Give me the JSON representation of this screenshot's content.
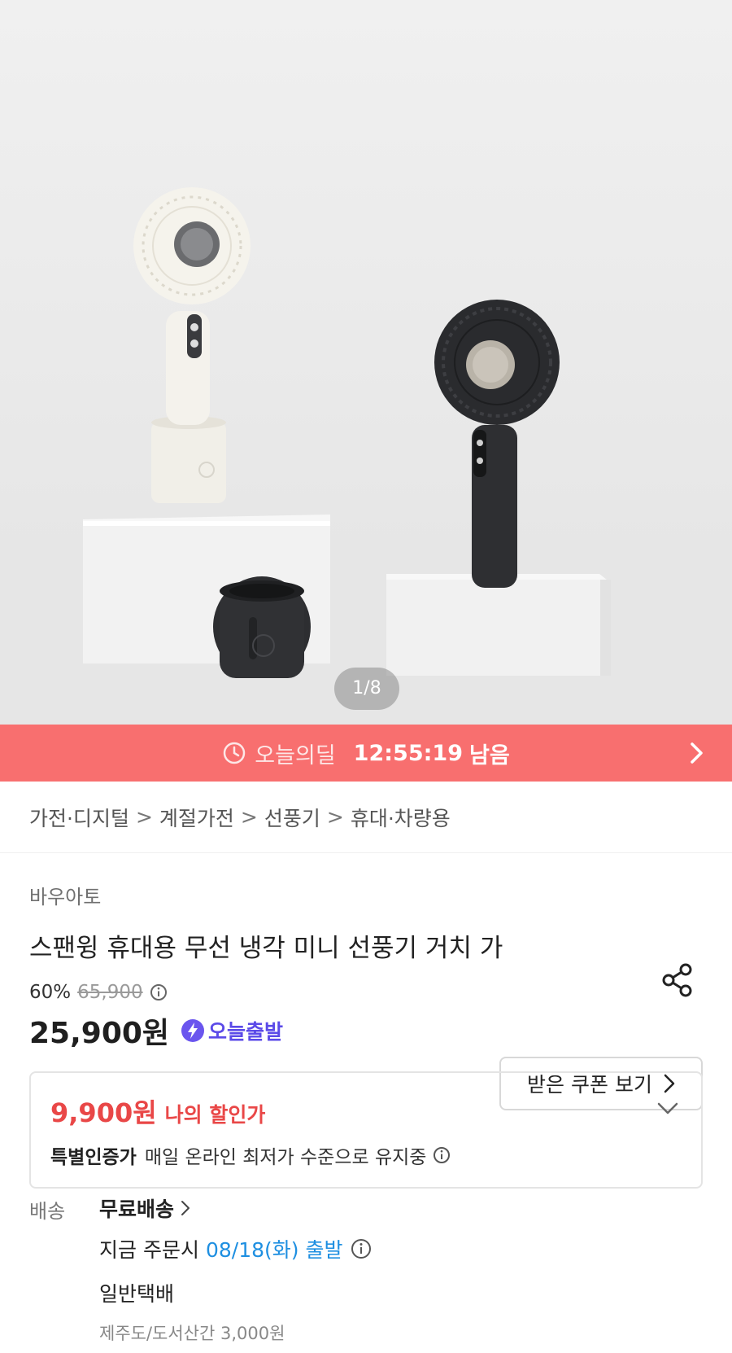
{
  "hero": {
    "image_counter": "1/8",
    "colors": {
      "background": "#ececec",
      "white_fan": "#f3f1ea",
      "black_fan": "#2f3033"
    }
  },
  "deal_banner": {
    "label": "오늘의딜",
    "timer": "12:55:19",
    "suffix": "남음",
    "background": "#f86f6f",
    "icons": [
      "clock-icon",
      "chevron-right-icon"
    ]
  },
  "breadcrumb": {
    "items": [
      "가전·디지털",
      "계절가전",
      "선풍기",
      "휴대·차량용"
    ],
    "separator": ">"
  },
  "product": {
    "brand": "바우아토",
    "title": "스팬윙 휴대용 무선 냉각 미니 선풍기 거치 가",
    "discount_rate": "60%",
    "original_price": "65,900",
    "price": "25,900원",
    "badge": "오늘출발",
    "coupon_button": "받은 쿠폰 보기",
    "accent_color": "#5b4ae8"
  },
  "my_deal": {
    "price": "9,900원",
    "label": "나의 할인가",
    "cert_title": "특별인증가",
    "cert_desc": "매일 온라인 최저가 수준으로 유지중",
    "accent_color": "#e94747"
  },
  "delivery": {
    "label": "배송",
    "free_shipping": "무료배송",
    "order_prefix": "지금 주문시",
    "ship_date": "08/18(화) 출발",
    "carrier": "일반택배",
    "extra_fee": "제주도/도서산간 3,000원",
    "date_color": "#1e8fe1"
  }
}
